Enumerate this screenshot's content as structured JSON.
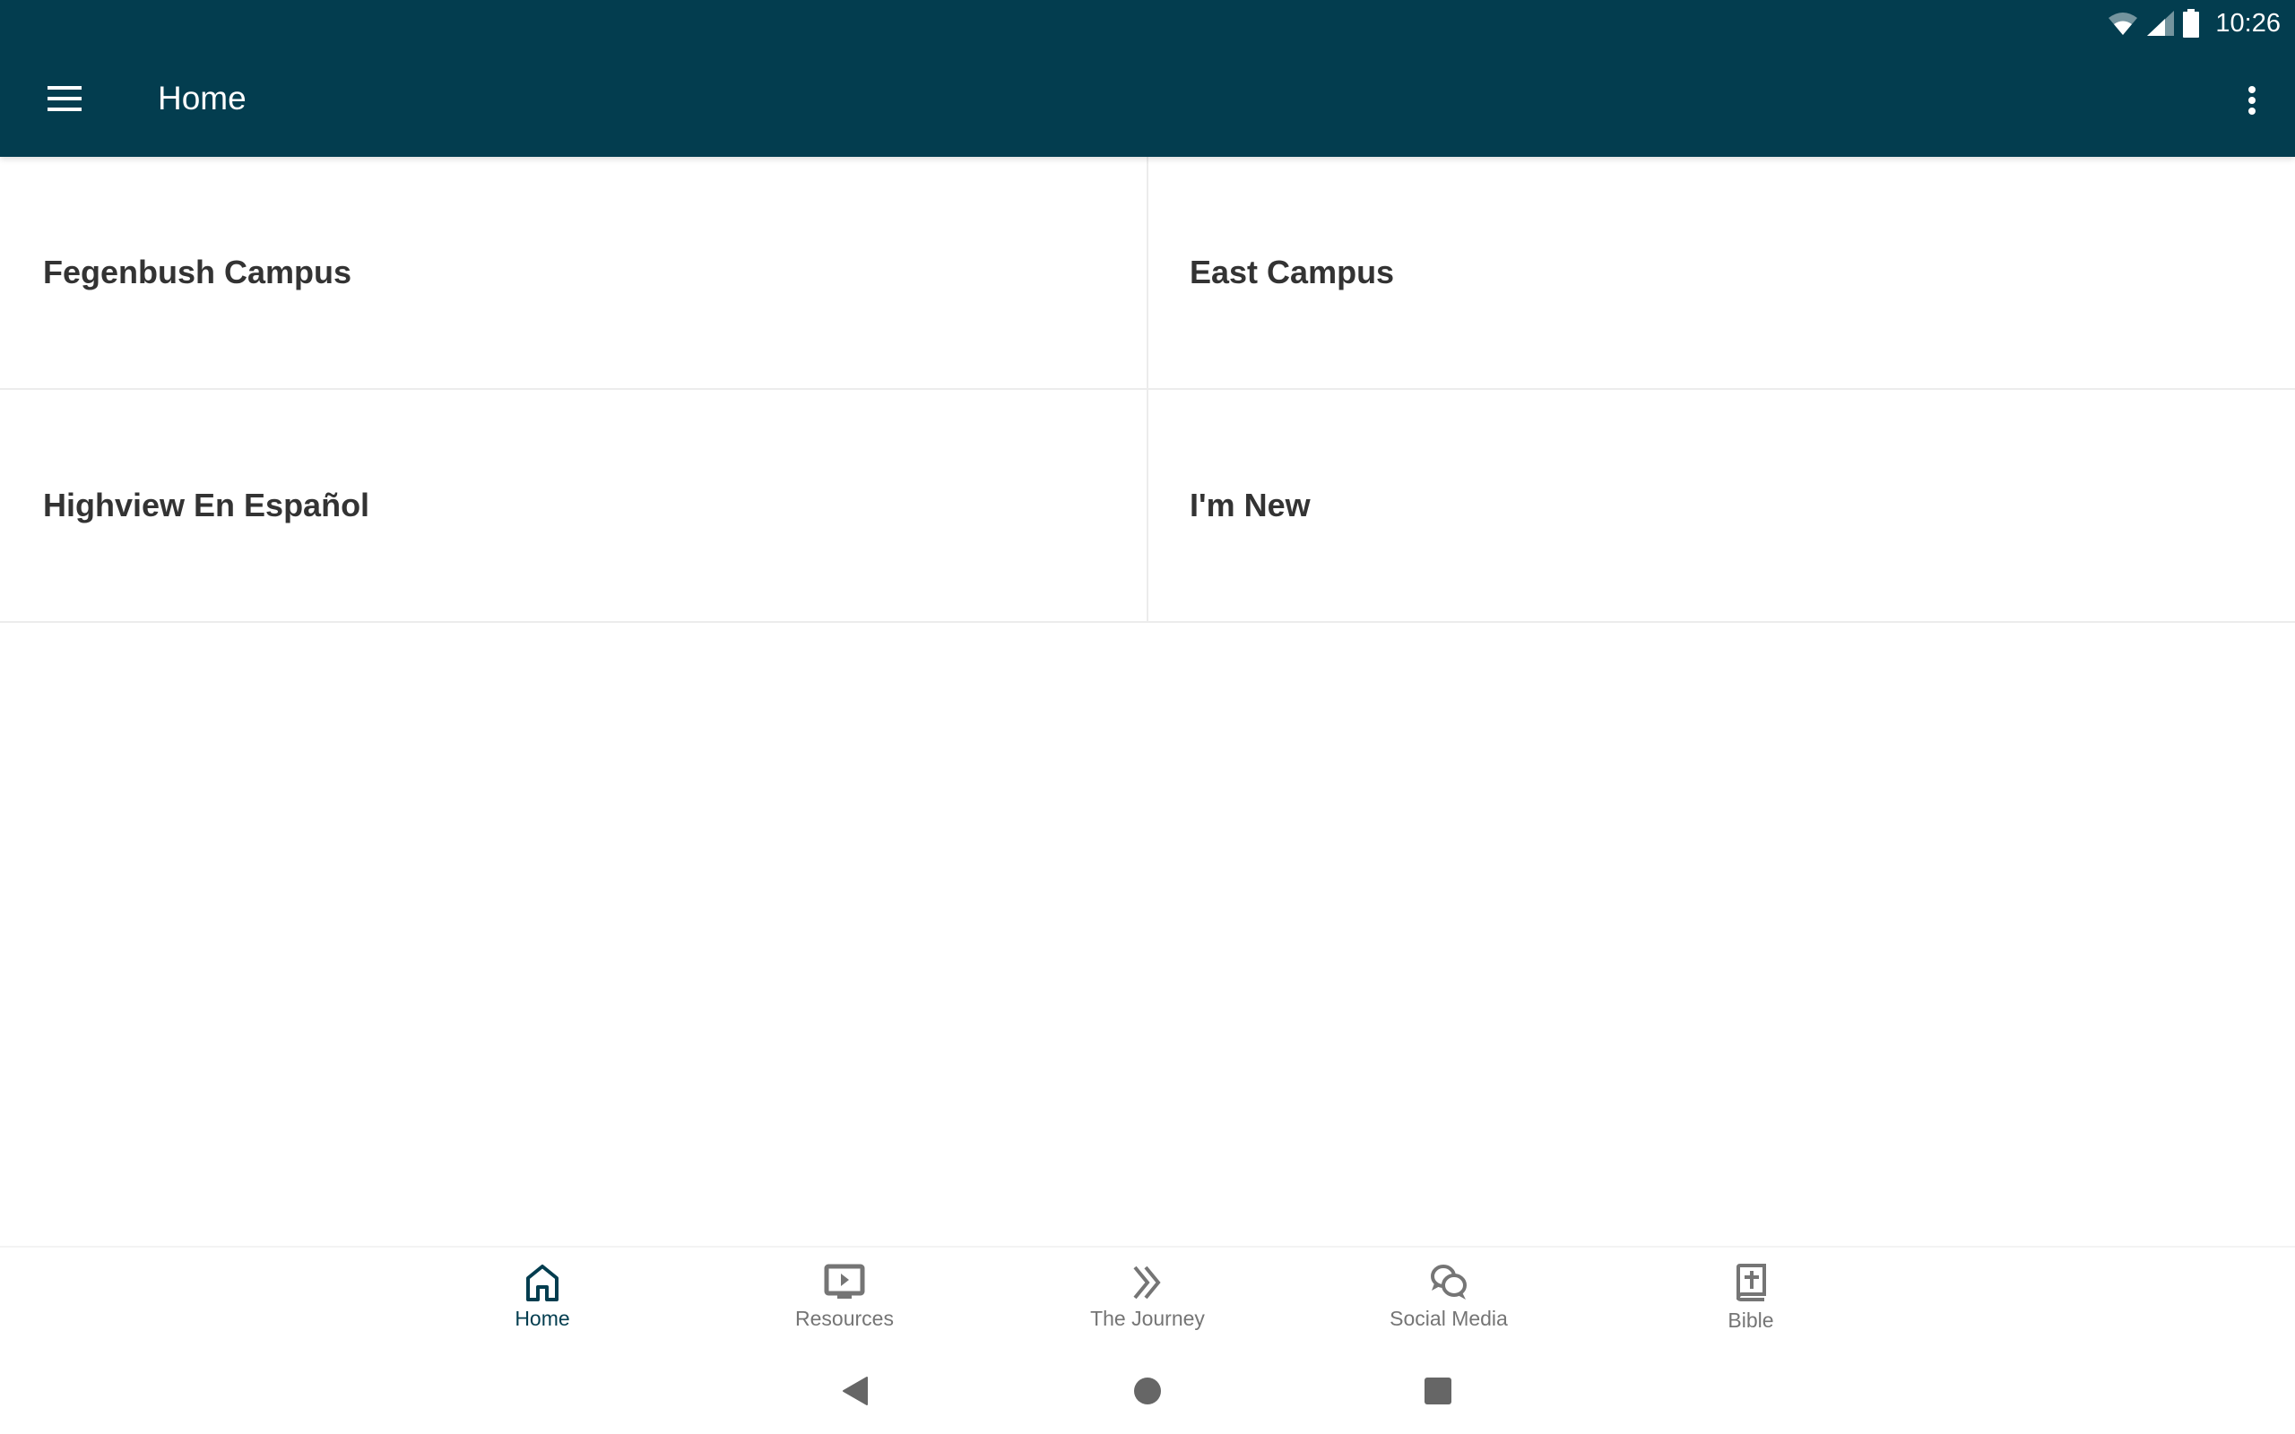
{
  "status_bar": {
    "time": "10:26",
    "icons": [
      "wifi-icon",
      "cell-signal-icon",
      "battery-icon"
    ]
  },
  "app_bar": {
    "title": "Home",
    "menu_icon": "hamburger-menu-icon",
    "overflow_icon": "more-vert-icon",
    "color": "#033d4f"
  },
  "tiles": [
    {
      "label": "Fegenbush Campus"
    },
    {
      "label": "East Campus"
    },
    {
      "label": "Highview En Español"
    },
    {
      "label": "I'm New"
    }
  ],
  "bottom_nav": {
    "active_index": 0,
    "active_color": "#033d4f",
    "inactive_color": "#757575",
    "items": [
      {
        "label": "Home",
        "icon": "home-icon"
      },
      {
        "label": "Resources",
        "icon": "tv-play-icon"
      },
      {
        "label": "The Journey",
        "icon": "double-chevron-right-icon"
      },
      {
        "label": "Social Media",
        "icon": "chat-bubbles-icon"
      },
      {
        "label": "Bible",
        "icon": "bible-icon"
      }
    ]
  },
  "system_nav": {
    "buttons": [
      "back",
      "home",
      "recents"
    ]
  }
}
